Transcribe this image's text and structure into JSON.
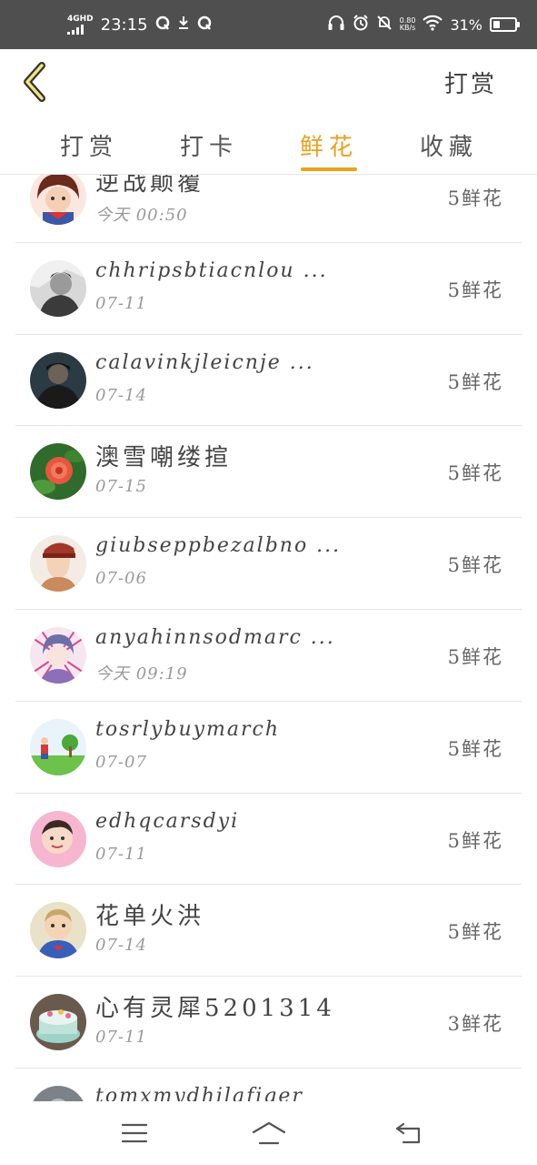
{
  "status_bar": {
    "network": "4GHD",
    "time": "23:15",
    "speed_value": "0.80",
    "speed_unit": "KB/s",
    "battery": "31%",
    "battery_level": 0.31
  },
  "header": {
    "action_label": "打赏"
  },
  "tabs": [
    {
      "label": "打赏",
      "active": false
    },
    {
      "label": "打卡",
      "active": false
    },
    {
      "label": "鲜花",
      "active": true
    },
    {
      "label": "收藏",
      "active": false
    }
  ],
  "colors": {
    "accent": "#e8a21c",
    "status_bar_bg": "#4f4f4f"
  },
  "list": [
    {
      "name": "逆战颠覆",
      "date": "今天 00:50",
      "amount": "5鲜花",
      "avatar": "cartoon-girl-avatar"
    },
    {
      "name": "chhripsbtiacnlou ...",
      "date": "07-11",
      "amount": "5鲜花",
      "avatar": "bw-man-avatar"
    },
    {
      "name": "calavinkjleicnje ...",
      "date": "07-14",
      "amount": "5鲜花",
      "avatar": "dark-man-avatar"
    },
    {
      "name": "澳雪嘲缕揎",
      "date": "07-15",
      "amount": "5鲜花",
      "avatar": "red-flower-avatar"
    },
    {
      "name": "giubseppbezalbno ...",
      "date": "07-06",
      "amount": "5鲜花",
      "avatar": "anime-boy-avatar"
    },
    {
      "name": "anyahinnsodmarc ...",
      "date": "今天 09:19",
      "amount": "5鲜花",
      "avatar": "anime-pink-avatar"
    },
    {
      "name": "tosrlybuymarch",
      "date": "07-07",
      "amount": "5鲜花",
      "avatar": "kid-tree-avatar"
    },
    {
      "name": "edhqcarsdyi",
      "date": "07-11",
      "amount": "5鲜花",
      "avatar": "baby-pink-avatar"
    },
    {
      "name": "花单火洪",
      "date": "07-14",
      "amount": "5鲜花",
      "avatar": "toddler-avatar"
    },
    {
      "name": "心有灵犀5201314",
      "date": "07-11",
      "amount": "3鲜花",
      "avatar": "cake-avatar"
    },
    {
      "name": "tomxmydhilafiger",
      "date": "",
      "amount": "",
      "avatar": "gray-avatar"
    }
  ]
}
